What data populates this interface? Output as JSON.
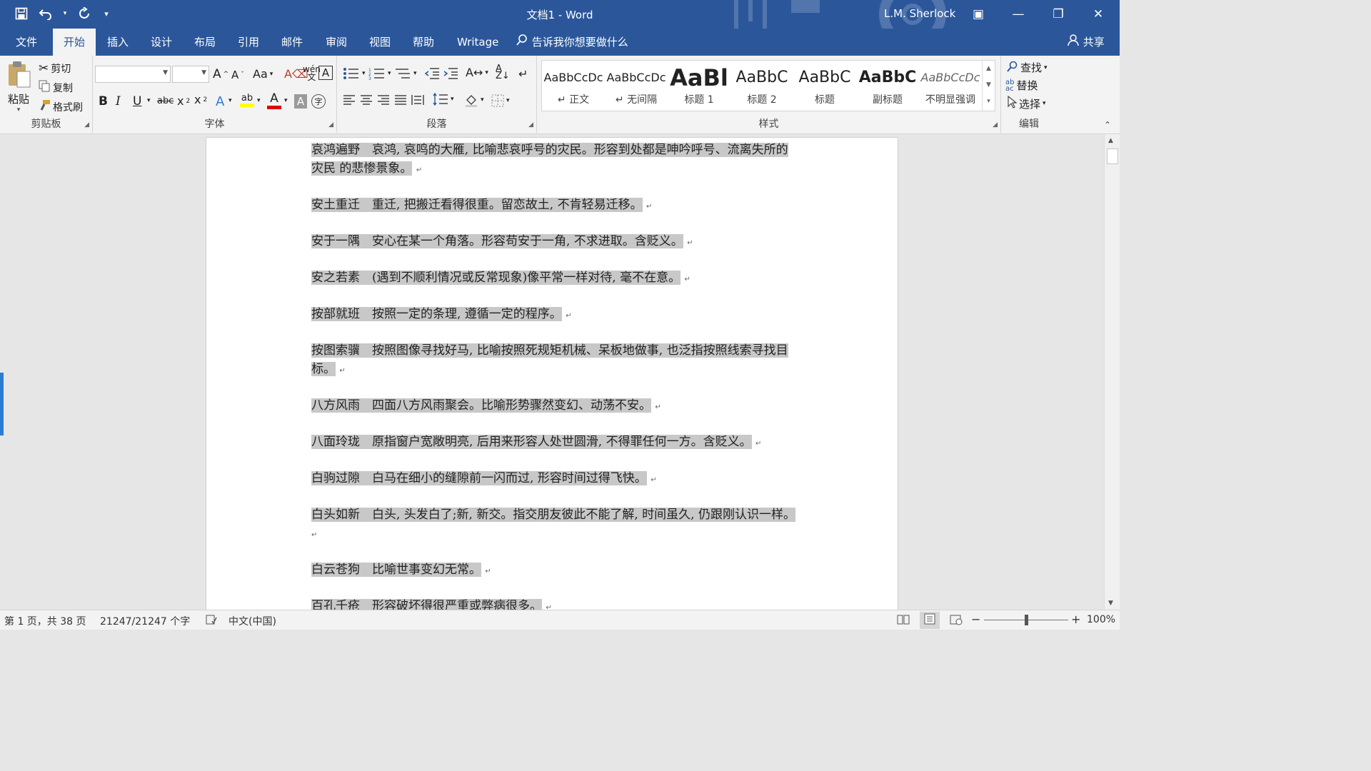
{
  "window": {
    "title": "文档1  -  Word",
    "user": "L.M. Sherlock",
    "controls": {
      "ribbon_display": "▣",
      "minimize": "—",
      "restore": "❐",
      "close": "✕"
    }
  },
  "quick_access": {
    "save": "save-icon",
    "undo": "undo-icon",
    "redo": "redo-icon",
    "customize": "customize-icon"
  },
  "tabs": [
    "文件",
    "开始",
    "插入",
    "设计",
    "布局",
    "引用",
    "邮件",
    "审阅",
    "视图",
    "帮助",
    "Writage"
  ],
  "active_tab": "开始",
  "tell_me": "告诉我你想要做什么",
  "share": "共享",
  "ribbon": {
    "clipboard": {
      "label": "剪贴板",
      "paste": "粘贴",
      "cut": "剪切",
      "copy": "复制",
      "format_painter": "格式刷"
    },
    "font": {
      "label": "字体",
      "font_name": "",
      "font_size": "",
      "change_case": "Aa"
    },
    "paragraph": {
      "label": "段落"
    },
    "styles": {
      "label": "样式",
      "items": [
        {
          "sample": "AaBbCcDc",
          "name": "↵ 正文"
        },
        {
          "sample": "AaBbCcDc",
          "name": "↵ 无间隔"
        },
        {
          "sample": "AaBl",
          "name": "标题 1"
        },
        {
          "sample": "AaBbC",
          "name": "标题 2"
        },
        {
          "sample": "AaBbC",
          "name": "标题"
        },
        {
          "sample": "AaBbC",
          "name": "副标题"
        },
        {
          "sample": "AaBbCcDc",
          "name": "不明显强调"
        }
      ]
    },
    "editing": {
      "label": "编辑",
      "find": "查找",
      "replace": "替换",
      "select": "选择"
    }
  },
  "document": {
    "entries": [
      {
        "text": "哀鸿遍野　哀鸿, 哀鸣的大雁, 比喻悲哀呼号的灾民。形容到处都是呻吟呼号、流离失所的灾民  的悲惨景象。"
      },
      {
        "text": "安土重迁　重迁, 把搬迁看得很重。留恋故土, 不肯轻易迁移。"
      },
      {
        "text": "安于一隅　安心在某一个角落。形容苟安于一角, 不求进取。含贬义。"
      },
      {
        "text": "安之若素　(遇到不顺利情况或反常现象)像平常一样对待, 毫不在意。"
      },
      {
        "text": "按部就班　按照一定的条理, 遵循一定的程序。"
      },
      {
        "text": "按图索骥　按照图像寻找好马, 比喻按照死规矩机械、呆板地做事, 也泛指按照线索寻找目标。"
      },
      {
        "text": "八方风雨　四面八方风雨聚会。比喻形势骤然变幻、动荡不安。"
      },
      {
        "text": "八面玲珑　原指窗户宽敞明亮, 后用来形容人处世圆滑, 不得罪任何一方。含贬义。"
      },
      {
        "text": "白驹过隙　白马在细小的缝隙前一闪而过, 形容时间过得飞快。"
      },
      {
        "text": "白头如新　白头, 头发白了;新, 新交。指交朋友彼此不能了解, 时间虽久, 仍跟刚认识一样。"
      },
      {
        "text": "白云苍狗　比喻世事变幻无常。"
      },
      {
        "text": "百孔千疮　形容破坏得很严重或弊病很多。"
      }
    ]
  },
  "status": {
    "page": "第 1 页，共 38 页",
    "words": "21247/21247 个字",
    "language": "中文(中国)",
    "zoom": "100%",
    "zoom_level": 1.0
  }
}
